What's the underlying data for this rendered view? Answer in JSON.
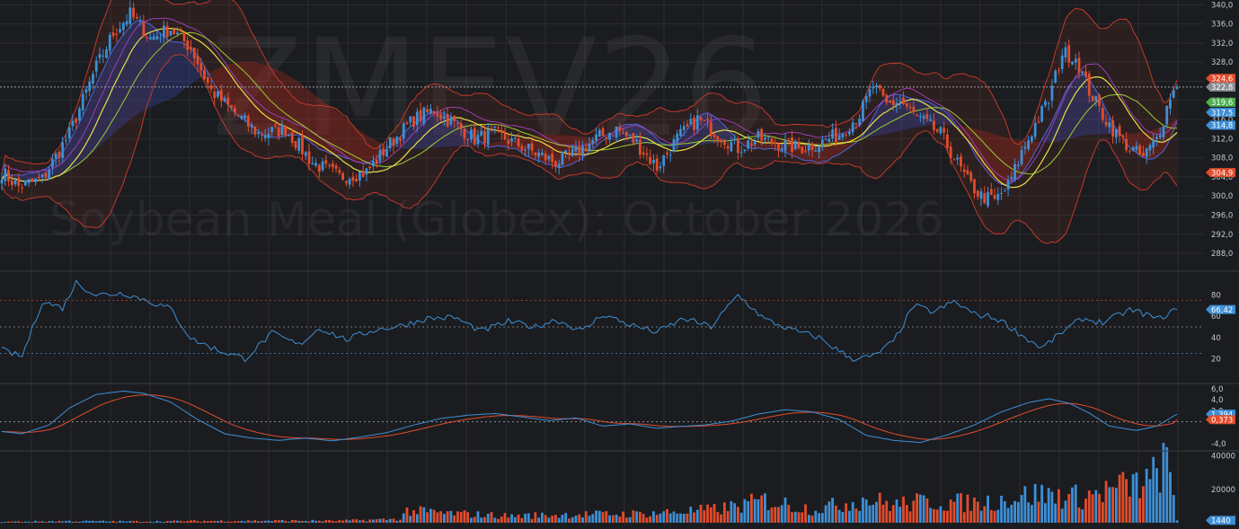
{
  "watermark": {
    "symbol": "ZMEV26",
    "name": "Soybean Meal (Globex): October 2026"
  },
  "colors": {
    "background": "#1b1c1f",
    "grid": "#2a2c31",
    "up": "#3d8fd6",
    "down": "#e24c2c",
    "axis_text": "#c5c9cf",
    "bollinger": "#c0392b",
    "ma_fast": "#e6e046",
    "ma_slow": "#9acd32",
    "ma_purple": "#9b3fb5",
    "rsi_line": "#3d8fd6",
    "macd_line": "#3d8fd6",
    "signal_line": "#e24c2c"
  },
  "chart_data": [
    {
      "type": "candlestick",
      "panel": "price",
      "ylim": [
        285,
        341
      ],
      "yticks": [
        "340,0",
        "336,0",
        "332,0",
        "328,0",
        "324,0",
        "320,0",
        "316,0",
        "312,0",
        "308,0",
        "304,0",
        "300,0",
        "296,0",
        "292,0",
        "288,0"
      ],
      "price_labels": [
        {
          "text": "324,6",
          "value": 324.6,
          "color": "#e24c2c"
        },
        {
          "text": "322,8",
          "value": 322.8,
          "color": "#8a8d93"
        },
        {
          "text": "319,6",
          "value": 319.6,
          "color": "#4caf50"
        },
        {
          "text": "317,5",
          "value": 317.5,
          "color": "#3d8fd6"
        },
        {
          "text": "314,8",
          "value": 314.8,
          "color": "#3d8fd6"
        },
        {
          "text": "304,9",
          "value": 304.9,
          "color": "#e24c2c"
        }
      ],
      "last_price_line": 322.8,
      "close_anchors": [
        [
          0,
          305
        ],
        [
          5,
          302
        ],
        [
          12,
          303.5
        ],
        [
          20,
          313
        ],
        [
          28,
          327
        ],
        [
          33,
          334
        ],
        [
          38,
          338
        ],
        [
          44,
          333
        ],
        [
          50,
          335
        ],
        [
          56,
          331
        ],
        [
          62,
          322
        ],
        [
          68,
          318
        ],
        [
          76,
          313
        ],
        [
          84,
          314
        ],
        [
          92,
          307
        ],
        [
          100,
          304
        ],
        [
          108,
          305
        ],
        [
          115,
          311
        ],
        [
          122,
          316
        ],
        [
          128,
          318
        ],
        [
          134,
          315
        ],
        [
          140,
          312
        ],
        [
          146,
          313
        ],
        [
          152,
          311
        ],
        [
          158,
          309
        ],
        [
          164,
          307
        ],
        [
          170,
          309
        ],
        [
          176,
          312
        ],
        [
          182,
          314
        ],
        [
          188,
          311
        ],
        [
          194,
          306
        ],
        [
          200,
          312
        ],
        [
          206,
          316
        ],
        [
          212,
          313
        ],
        [
          218,
          310
        ],
        [
          224,
          312
        ],
        [
          230,
          311
        ],
        [
          236,
          310
        ],
        [
          242,
          311
        ],
        [
          248,
          313
        ],
        [
          254,
          317
        ],
        [
          258,
          323
        ],
        [
          262,
          319
        ],
        [
          266,
          320
        ],
        [
          270,
          317
        ],
        [
          274,
          315
        ],
        [
          278,
          313
        ],
        [
          282,
          308
        ],
        [
          286,
          303
        ],
        [
          290,
          300
        ],
        [
          294,
          299
        ],
        [
          298,
          302
        ],
        [
          302,
          309
        ],
        [
          306,
          315
        ],
        [
          310,
          320
        ],
        [
          314,
          330
        ],
        [
          318,
          329
        ],
        [
          322,
          322
        ],
        [
          326,
          317
        ],
        [
          330,
          313
        ],
        [
          334,
          310
        ],
        [
          338,
          308
        ],
        [
          342,
          312
        ],
        [
          344,
          316
        ],
        [
          346,
          321
        ],
        [
          348,
          322.8
        ]
      ],
      "rsi_anchors": [
        [
          0,
          28
        ],
        [
          6,
          22
        ],
        [
          12,
          74
        ],
        [
          18,
          68
        ],
        [
          22,
          92
        ],
        [
          28,
          80
        ],
        [
          36,
          82
        ],
        [
          42,
          76
        ],
        [
          50,
          67
        ],
        [
          56,
          39
        ],
        [
          64,
          28
        ],
        [
          72,
          20
        ],
        [
          80,
          44
        ],
        [
          88,
          33
        ],
        [
          94,
          49
        ],
        [
          102,
          38
        ],
        [
          110,
          47
        ],
        [
          118,
          51
        ],
        [
          126,
          58
        ],
        [
          134,
          59
        ],
        [
          142,
          46
        ],
        [
          150,
          55
        ],
        [
          158,
          50
        ],
        [
          164,
          57
        ],
        [
          172,
          46
        ],
        [
          178,
          62
        ],
        [
          186,
          52
        ],
        [
          194,
          45
        ],
        [
          202,
          58
        ],
        [
          210,
          50
        ],
        [
          218,
          80
        ],
        [
          226,
          57
        ],
        [
          234,
          47
        ],
        [
          242,
          40
        ],
        [
          248,
          27
        ],
        [
          252,
          20
        ],
        [
          258,
          22
        ],
        [
          264,
          36
        ],
        [
          270,
          70
        ],
        [
          276,
          64
        ],
        [
          282,
          74
        ],
        [
          288,
          62
        ],
        [
          292,
          60
        ],
        [
          296,
          56
        ],
        [
          302,
          42
        ],
        [
          308,
          30
        ],
        [
          314,
          45
        ],
        [
          320,
          58
        ],
        [
          326,
          54
        ],
        [
          330,
          60
        ],
        [
          334,
          66
        ],
        [
          339,
          62
        ],
        [
          342,
          57
        ],
        [
          348,
          66.42
        ]
      ],
      "macd_anchors": [
        [
          0,
          -1.8
        ],
        [
          6,
          -2.2
        ],
        [
          14,
          -0.6
        ],
        [
          20,
          2.5
        ],
        [
          28,
          5.0
        ],
        [
          36,
          5.6
        ],
        [
          42,
          5.2
        ],
        [
          50,
          3.6
        ],
        [
          58,
          0.4
        ],
        [
          66,
          -2.2
        ],
        [
          74,
          -3.0
        ],
        [
          82,
          -3.4
        ],
        [
          90,
          -3.0
        ],
        [
          98,
          -3.5
        ],
        [
          106,
          -2.8
        ],
        [
          114,
          -2.0
        ],
        [
          122,
          -0.6
        ],
        [
          130,
          0.6
        ],
        [
          138,
          1.2
        ],
        [
          146,
          1.5
        ],
        [
          154,
          0.9
        ],
        [
          162,
          0.2
        ],
        [
          170,
          0.7
        ],
        [
          178,
          -0.8
        ],
        [
          186,
          -0.4
        ],
        [
          194,
          -1.2
        ],
        [
          200,
          -0.9
        ],
        [
          208,
          -0.6
        ],
        [
          216,
          0.1
        ],
        [
          224,
          1.4
        ],
        [
          232,
          2.2
        ],
        [
          240,
          1.8
        ],
        [
          248,
          0.4
        ],
        [
          256,
          -2.5
        ],
        [
          264,
          -3.4
        ],
        [
          272,
          -3.8
        ],
        [
          280,
          -2.4
        ],
        [
          288,
          -0.6
        ],
        [
          296,
          1.8
        ],
        [
          304,
          3.5
        ],
        [
          310,
          4.2
        ],
        [
          316,
          3.4
        ],
        [
          322,
          1.6
        ],
        [
          328,
          -0.8
        ],
        [
          336,
          -1.6
        ],
        [
          342,
          -0.8
        ],
        [
          348,
          1.394
        ]
      ],
      "vol_anchors": [
        [
          0,
          700
        ],
        [
          20,
          1100
        ],
        [
          40,
          900
        ],
        [
          60,
          1200
        ],
        [
          80,
          1400
        ],
        [
          100,
          1300
        ],
        [
          118,
          2500
        ],
        [
          120,
          8000
        ],
        [
          130,
          6500
        ],
        [
          150,
          4500
        ],
        [
          170,
          5500
        ],
        [
          190,
          6000
        ],
        [
          210,
          8500
        ],
        [
          218,
          11000
        ],
        [
          226,
          15000
        ],
        [
          240,
          9000
        ],
        [
          248,
          12000
        ],
        [
          256,
          16000
        ],
        [
          264,
          12000
        ],
        [
          274,
          14000
        ],
        [
          290,
          13000
        ],
        [
          306,
          19000
        ],
        [
          320,
          17000
        ],
        [
          332,
          24000
        ],
        [
          340,
          27000
        ],
        [
          344,
          40000
        ],
        [
          346,
          30000
        ],
        [
          348,
          1440
        ]
      ]
    },
    {
      "type": "line",
      "panel": "rsi",
      "ylim": [
        0,
        100
      ],
      "yticks": [
        "80",
        "60",
        "40",
        "20"
      ],
      "levels": [
        75,
        50,
        25
      ],
      "last_label": {
        "text": "66,42",
        "value": 66.42
      }
    },
    {
      "type": "line",
      "panel": "macd",
      "ylim": [
        -5,
        6.5
      ],
      "yticks": [
        "6,0",
        "4,0",
        "2,0",
        "-4,0"
      ],
      "labels": [
        {
          "text": "1,394",
          "value": 1.394,
          "color": "#3d8fd6"
        },
        {
          "text": "0,373",
          "value": 0.373,
          "color": "#e24c2c"
        }
      ]
    },
    {
      "type": "bar",
      "panel": "volume",
      "ylim": [
        0,
        42000
      ],
      "yticks": [
        "40000",
        "20000"
      ],
      "last_label": {
        "text": "1440",
        "value": 1440
      }
    }
  ]
}
